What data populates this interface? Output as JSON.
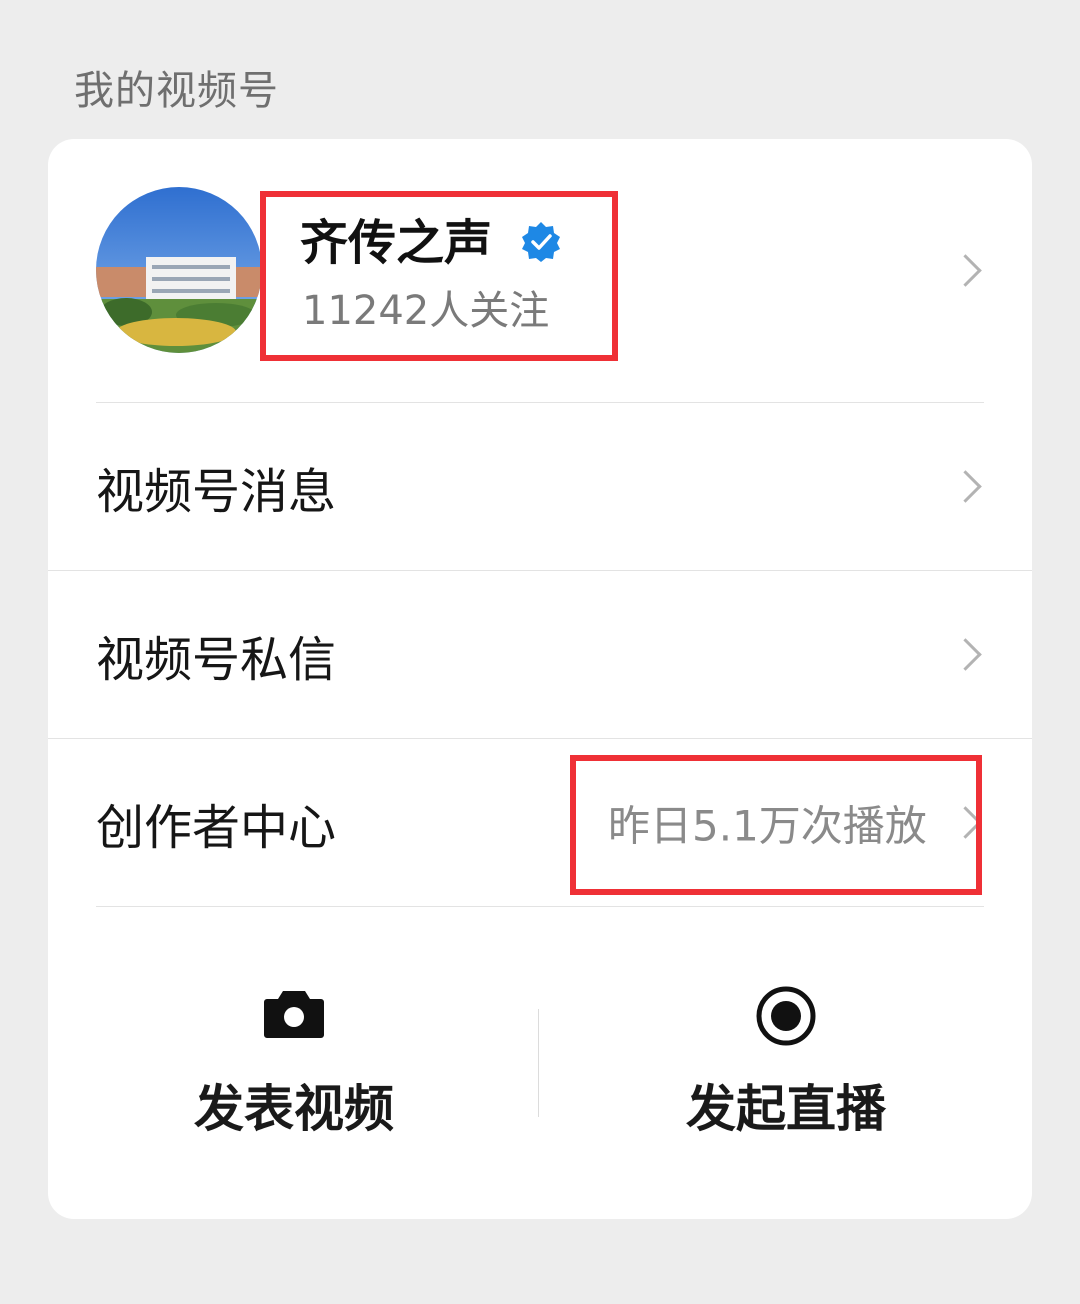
{
  "section_title": "我的视频号",
  "profile": {
    "name": "齐传之声",
    "followers": "11242人关注",
    "verified_icon": "verified-badge-icon"
  },
  "menu": [
    {
      "label": "视频号消息"
    },
    {
      "label": "视频号私信"
    },
    {
      "label": "创作者中心",
      "value": "昨日5.1万次播放"
    }
  ],
  "actions": [
    {
      "label": "发表视频",
      "icon": "camera-icon"
    },
    {
      "label": "发起直播",
      "icon": "live-record-icon"
    }
  ],
  "colors": {
    "background": "#ededed",
    "card": "#ffffff",
    "highlight": "#ef3036",
    "verified": "#1e88e5"
  }
}
